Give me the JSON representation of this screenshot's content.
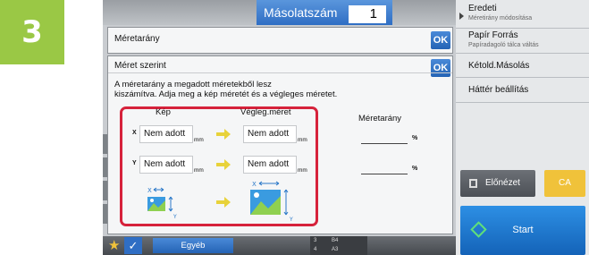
{
  "step": "3",
  "copies": {
    "label": "Másolatszám",
    "value": "1"
  },
  "right_panel": {
    "items": [
      {
        "title": "Eredeti",
        "subtitle": "Méretirány módosítása"
      },
      {
        "title": "Papír Forrás",
        "subtitle": "Papíradagoló tálca váltás"
      },
      {
        "title": "Kétold.Másolás",
        "subtitle": ""
      },
      {
        "title": "Háttér beállítás",
        "subtitle": ""
      }
    ],
    "preview_label": "Előnézet",
    "ca_label": "CA",
    "start_label": "Start"
  },
  "dialog_ratio": {
    "title": "Méretarány",
    "ok": "OK"
  },
  "dialog_size": {
    "title": "Méret szerint",
    "ok": "OK",
    "description_line1": "A méretarány a megadott méretekből lesz",
    "description_line2": "kiszámítva. Adja meg a kép méretét és a végleges méretet.",
    "col_image": "Kép",
    "col_final": "Végleg.méret",
    "axis_x": "X",
    "axis_y": "Y",
    "field_x_image": "Nem adott",
    "field_x_final": "Nem adott",
    "field_y_image": "Nem adott",
    "field_y_final": "Nem adott",
    "unit": "mm",
    "ratio_header": "Méretarány",
    "ratio_x": "",
    "ratio_y": "",
    "percent": "%"
  },
  "bottom_bar": {
    "other_label": "Egyéb",
    "paper_top": "B4",
    "paper_bottom": "A3",
    "tray_a": "3",
    "tray_b": "4"
  },
  "colors": {
    "accent_blue": "#2f6ec4",
    "highlight_red": "#d6223b",
    "step_green": "#9ac845",
    "arrow_yellow": "#e8d23a"
  }
}
